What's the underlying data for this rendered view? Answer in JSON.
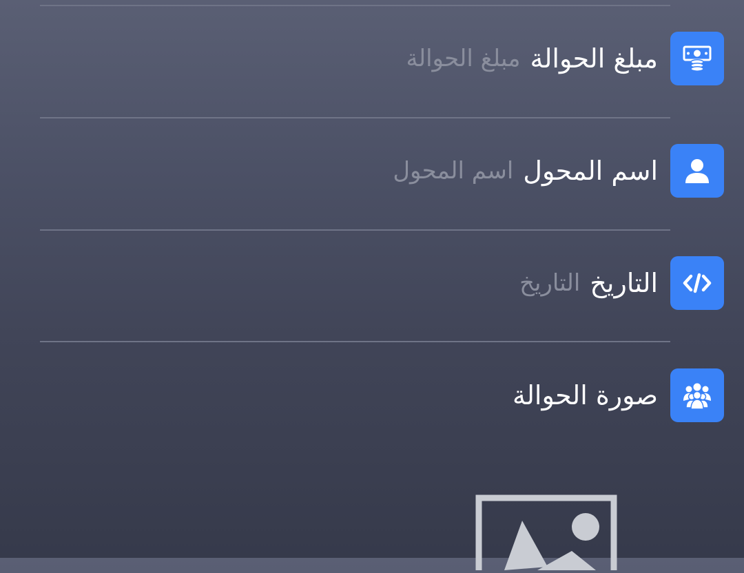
{
  "form": {
    "fields": [
      {
        "label": "مبلغ الحوالة",
        "placeholder": "مبلغ الحوالة",
        "icon": "money-icon"
      },
      {
        "label": "اسم المحول",
        "placeholder": "اسم المحول",
        "icon": "user-icon"
      },
      {
        "label": "التاريخ",
        "placeholder": "التاريخ",
        "icon": "code-icon"
      },
      {
        "label": "صورة الحوالة",
        "icon": "group-icon"
      }
    ],
    "image_placeholder_icon": "image-icon"
  },
  "colors": {
    "background_top": "#5a5f74",
    "background_bottom": "#363a4b",
    "icon_background": "#3a82f7",
    "label": "#ffffff",
    "placeholder": "#8a8e9d",
    "divider": "#6f7487"
  }
}
